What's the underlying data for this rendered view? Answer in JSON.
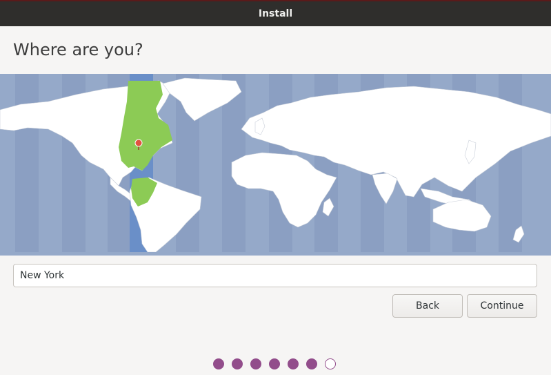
{
  "window": {
    "title": "Install"
  },
  "page": {
    "heading": "Where are you?"
  },
  "map": {
    "selected_timezone_highlight_color": "#8ccb55",
    "selected_band_color": "#6a8fc8",
    "ocean_color": "#95a9c9",
    "land_color": "#ffffff",
    "pin_color": "#e0523f"
  },
  "location": {
    "value": "New York"
  },
  "buttons": {
    "back_label": "Back",
    "continue_label": "Continue"
  },
  "progress": {
    "total_steps": 7,
    "completed_steps": 6,
    "accent_color": "#924d8b"
  }
}
